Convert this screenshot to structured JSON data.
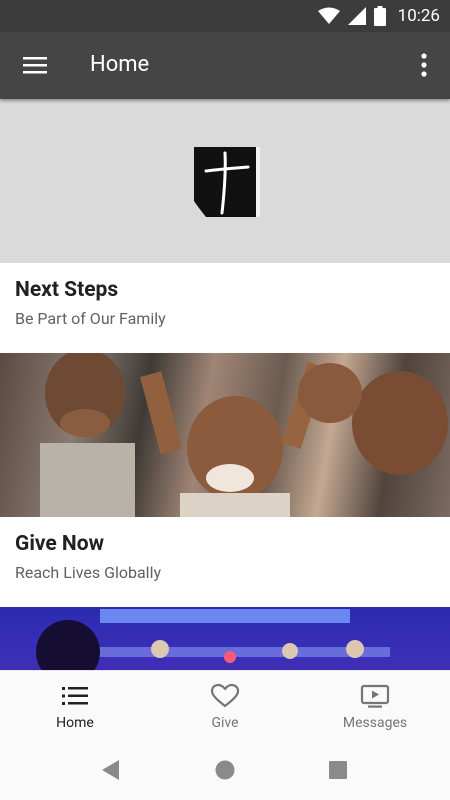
{
  "status_bar": {
    "time": "10:26"
  },
  "app_bar": {
    "title": "Home"
  },
  "feed": {
    "cards": [
      {
        "title": "Next Steps",
        "subtitle": "Be Part of Our Family"
      },
      {
        "title": "Give Now",
        "subtitle": "Reach Lives Globally"
      }
    ]
  },
  "bottom_nav": {
    "items": [
      {
        "label": "Home",
        "icon": "list-icon",
        "active": true
      },
      {
        "label": "Give",
        "icon": "heart-icon",
        "active": false
      },
      {
        "label": "Messages",
        "icon": "video-icon",
        "active": false
      }
    ]
  },
  "colors": {
    "status_bar": "#3c3c3c",
    "app_bar": "#454545",
    "nav_active": "#222222",
    "nav_inactive": "#757575"
  }
}
